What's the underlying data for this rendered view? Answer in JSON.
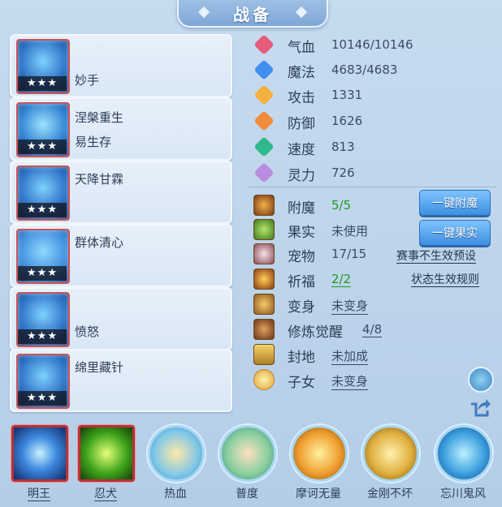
{
  "header": {
    "title": "战备"
  },
  "skills": [
    {
      "name": "妙手",
      "stars": "★★★"
    },
    {
      "name": "涅槃重生",
      "name2": "易生存",
      "stars": "★★★"
    },
    {
      "name": "天降甘霖",
      "stars": "★★★"
    },
    {
      "name": "群体清心",
      "stars": "★★★"
    },
    {
      "name": "愤怒",
      "stars": "★★★"
    },
    {
      "name": "绵里藏针",
      "stars": "★★★"
    }
  ],
  "stats": [
    {
      "label": "气血",
      "value": "10146/10146",
      "icon": "heart-icon",
      "color": "#e65a7a"
    },
    {
      "label": "魔法",
      "value": "4683/4683",
      "icon": "mana-icon",
      "color": "#3f8ff0"
    },
    {
      "label": "攻击",
      "value": "1331",
      "icon": "sword-icon",
      "color": "#f2b13c"
    },
    {
      "label": "防御",
      "value": "1626",
      "icon": "shield-icon",
      "color": "#ef8d3a"
    },
    {
      "label": "速度",
      "value": "813",
      "icon": "speed-icon",
      "color": "#2fb98c"
    },
    {
      "label": "灵力",
      "value": "726",
      "icon": "spirit-icon",
      "color": "#b88ee0"
    }
  ],
  "equip": [
    {
      "label": "附魔",
      "value": "5/5",
      "icon": "enchant-icon"
    },
    {
      "label": "果实",
      "value": "未使用",
      "icon": "fruit-icon"
    },
    {
      "label": "宠物",
      "value": "17/15",
      "icon": "pet-icon"
    },
    {
      "label": "祈福",
      "value": "2/2",
      "icon": "blessing-icon"
    },
    {
      "label": "变身",
      "value": "未变身",
      "icon": "transform-icon"
    },
    {
      "label": "修炼觉醒",
      "value": "4/8",
      "icon": "cultivation-icon"
    },
    {
      "label": "封地",
      "value": "未加成",
      "icon": "fief-icon"
    },
    {
      "label": "子女",
      "value": "未变身",
      "icon": "child-icon"
    }
  ],
  "buttons": {
    "enchant": "一键附魔",
    "fruit": "一键果实"
  },
  "links": {
    "event_preset": "赛事不生效预设",
    "status_rules": "状态生效规则"
  },
  "pets": [
    {
      "name": "明王"
    },
    {
      "name": "忍犬"
    },
    {
      "name": "热血"
    },
    {
      "name": "普度"
    },
    {
      "name": "摩诃无量"
    },
    {
      "name": "金刚不坏"
    },
    {
      "name": "忘川鬼风"
    }
  ]
}
